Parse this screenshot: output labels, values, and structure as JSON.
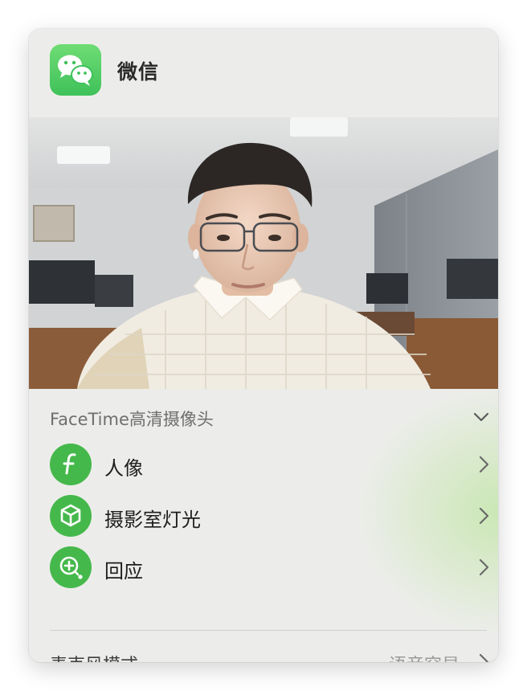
{
  "app": {
    "name": "微信",
    "icon": "wechat-icon",
    "accent": "#45b84b"
  },
  "video": {
    "description_icon": "camera-preview"
  },
  "camera": {
    "label": "FaceTime高清摄像头",
    "toggle_icon": "chevron-down-icon"
  },
  "effects": [
    {
      "label": "人像",
      "icon": "portrait-f-icon"
    },
    {
      "label": "摄影室灯光",
      "icon": "cube-icon"
    },
    {
      "label": "回应",
      "icon": "reactions-icon"
    }
  ],
  "mic": {
    "label": "麦克风模式",
    "value": "语音突显"
  }
}
